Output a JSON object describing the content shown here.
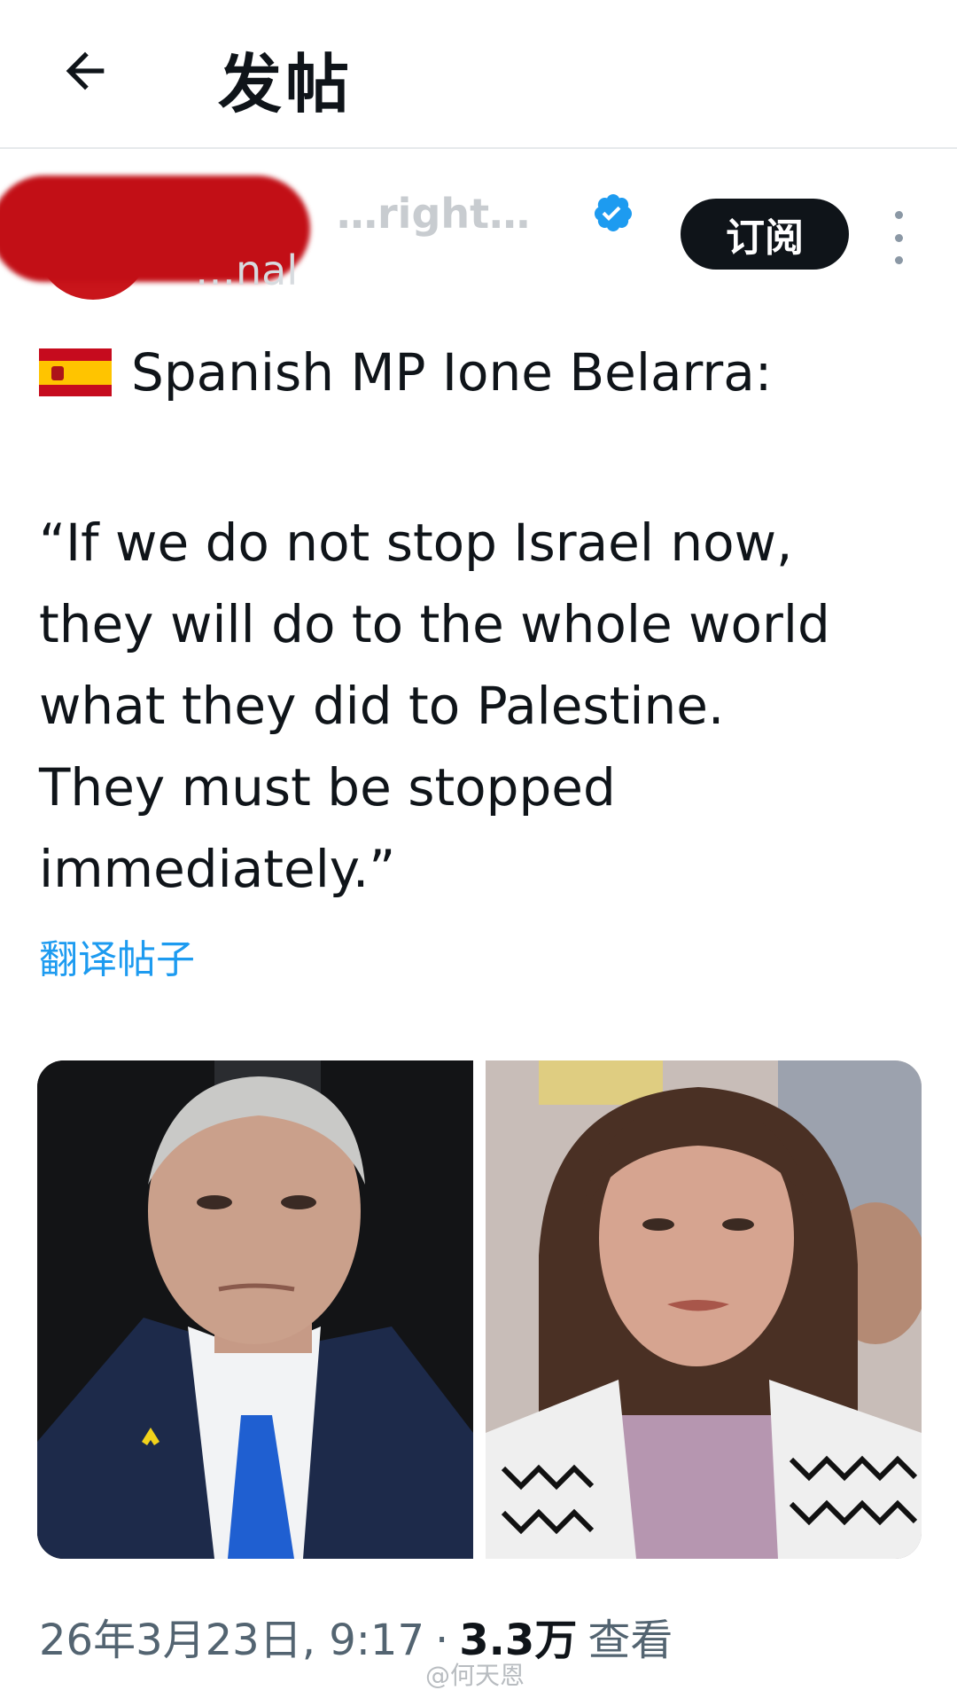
{
  "header": {
    "title": "发帖",
    "back_icon": "arrow-left-icon"
  },
  "author": {
    "name": "…right…",
    "handle": "…nal",
    "verified": true,
    "subscribe_label": "订阅",
    "more_icon": "more-vertical-icon",
    "avatar_redacted": true,
    "redaction_color": "#c20f16"
  },
  "post": {
    "flag_icon": "spain-flag-icon",
    "heading": "Spanish MP Ione Belarra:",
    "body": "“If we do not stop Israel now,\nthey will do to the whole world\nwhat they did to Palestine.\nThey must be stopped\nimmediately.”",
    "translate_label": "翻译帖子"
  },
  "media": {
    "images": [
      {
        "name": "photo-netanyahu"
      },
      {
        "name": "photo-belarra"
      }
    ]
  },
  "meta": {
    "timestamp": "26年3月23日, 9:17",
    "separator": "·",
    "views_count": "3.3万",
    "views_label": "查看"
  },
  "watermark": "@何天恩",
  "colors": {
    "accent": "#1d9bf0",
    "text": "#0f1419",
    "secondary": "#536471"
  }
}
